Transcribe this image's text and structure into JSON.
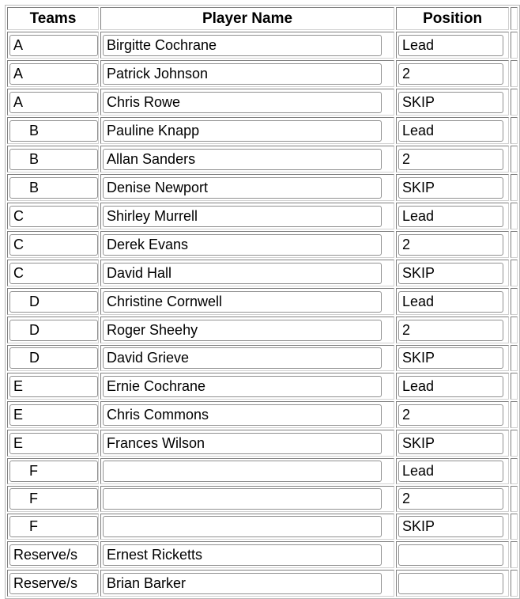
{
  "table": {
    "headers": [
      "Teams",
      "Player Name",
      "Position"
    ],
    "rows": [
      {
        "team": "A",
        "player": "Birgitte Cochrane",
        "position": "Lead"
      },
      {
        "team": "A",
        "player": "Patrick Johnson",
        "position": "2"
      },
      {
        "team": "A",
        "player": "Chris Rowe",
        "position": "SKIP"
      },
      {
        "team": "    B",
        "player": "Pauline Knapp",
        "position": "Lead"
      },
      {
        "team": "    B",
        "player": "Allan Sanders",
        "position": "2"
      },
      {
        "team": "    B",
        "player": "Denise Newport",
        "position": "SKIP"
      },
      {
        "team": "C",
        "player": "Shirley Murrell",
        "position": "Lead"
      },
      {
        "team": "C",
        "player": "Derek Evans",
        "position": "2"
      },
      {
        "team": "C",
        "player": "David Hall",
        "position": "SKIP"
      },
      {
        "team": "    D",
        "player": "Christine Cornwell",
        "position": "Lead"
      },
      {
        "team": "    D",
        "player": "Roger Sheehy",
        "position": "2"
      },
      {
        "team": "    D",
        "player": "David Grieve",
        "position": "SKIP"
      },
      {
        "team": "E",
        "player": "Ernie Cochrane",
        "position": "Lead"
      },
      {
        "team": "E",
        "player": "Chris Commons",
        "position": "2"
      },
      {
        "team": "E",
        "player": "Frances Wilson",
        "position": "SKIP"
      },
      {
        "team": "    F",
        "player": "",
        "position": "Lead"
      },
      {
        "team": "    F",
        "player": "",
        "position": "2"
      },
      {
        "team": "    F",
        "player": "",
        "position": "SKIP"
      },
      {
        "team": "Reserve/s",
        "player": "Ernest Ricketts",
        "position": ""
      },
      {
        "team": "Reserve/s",
        "player": "Brian Barker",
        "position": ""
      }
    ]
  }
}
